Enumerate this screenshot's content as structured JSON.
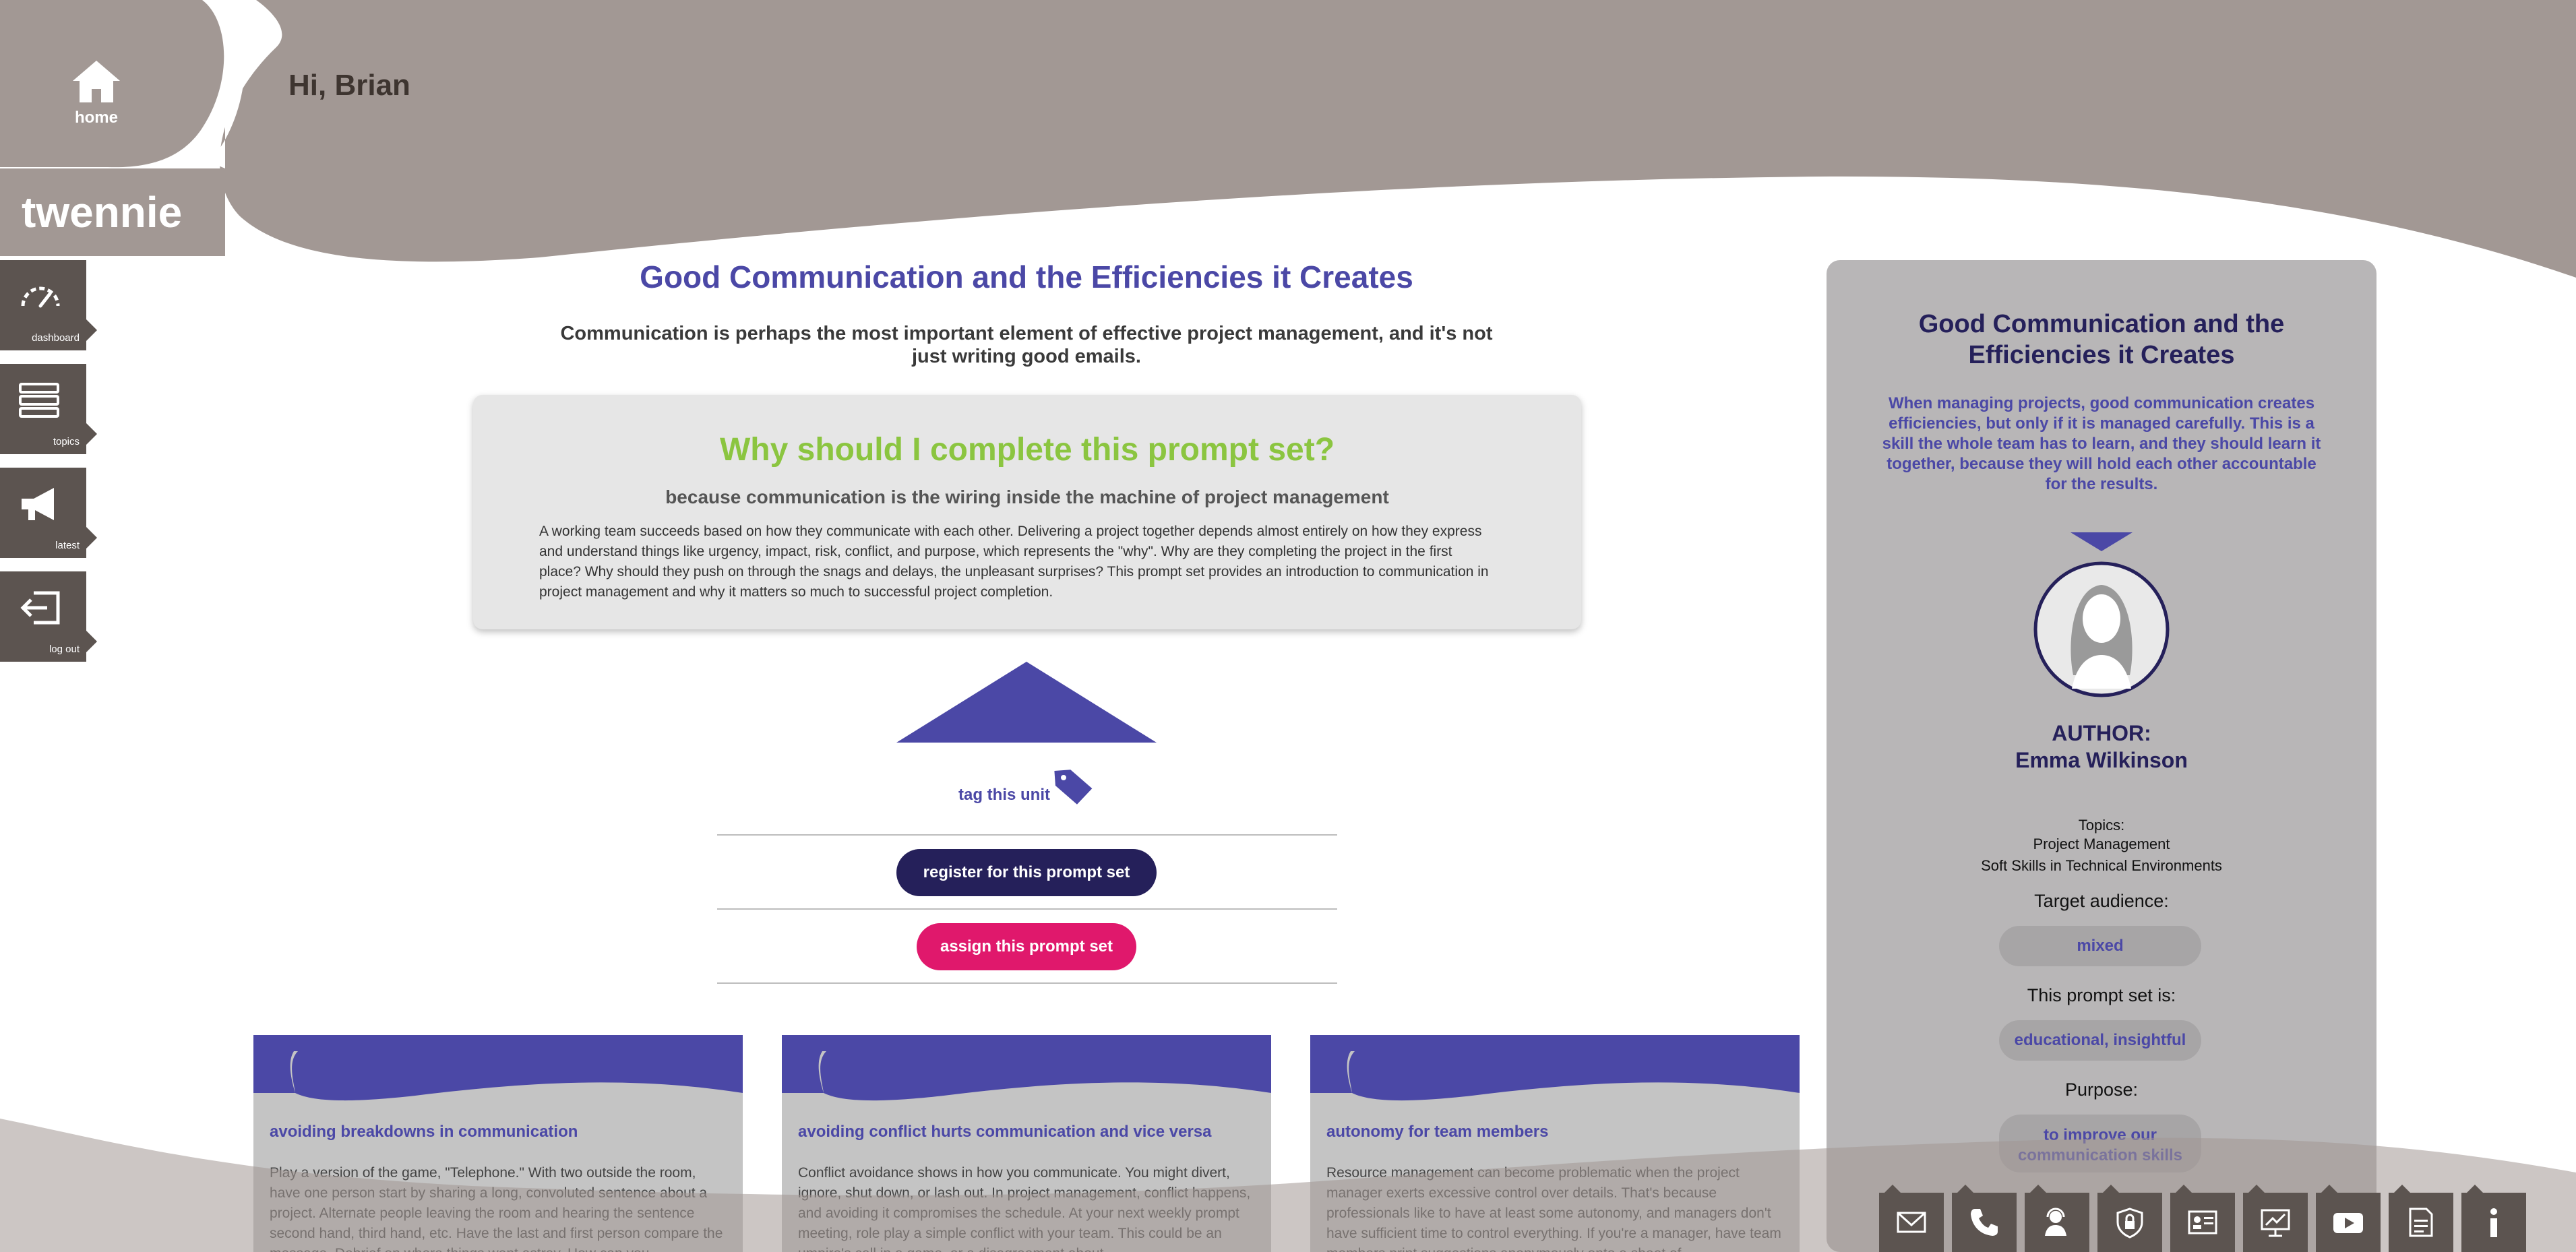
{
  "header": {
    "greeting": "Hi, Brian",
    "home_label": "home",
    "brand": "twennie"
  },
  "nav": {
    "items": [
      {
        "label": "dashboard",
        "icon": "speedometer-icon"
      },
      {
        "label": "topics",
        "icon": "list-icon"
      },
      {
        "label": "latest",
        "icon": "megaphone-icon"
      },
      {
        "label": "log out",
        "icon": "logout-icon"
      }
    ]
  },
  "main": {
    "title": "Good Communication and the Efficiencies it Creates",
    "subtitle": "Communication is perhaps the most important element of effective project management, and it's not just writing good emails.",
    "why": {
      "title": "Why should I complete this prompt set?",
      "subtitle": "because communication is the wiring inside the machine of project management",
      "body": "A working team succeeds based on how they communicate with each other. Delivering a project together depends almost entirely on how they express and understand things like urgency, impact, risk, conflict, and purpose, which represents the \"why\". Why are they completing the project in the first place? Why should they push on through the snags and delays, the unpleasant surprises? This prompt set provides an introduction to communication in project management and why it matters so much to successful project completion."
    },
    "tag_label": "tag this unit",
    "register_label": "register for this prompt set",
    "assign_label": "assign this prompt set"
  },
  "cards": [
    {
      "title": "avoiding breakdowns in communication",
      "body": "Play a version of the game, \"Telephone.\" With two outside the room, have one person start by sharing a long, convoluted sentence about a project. Alternate people leaving the room and hearing the sentence second hand, third hand, etc. Have the last and first person compare the message. Debrief on where things went astray. How can you"
    },
    {
      "title": "avoiding conflict hurts communication and vice versa",
      "body": "Conflict avoidance shows in how you communicate. You might divert, ignore, shut down, or lash out. In project management, conflict happens, and avoiding it compromises the schedule. At your next weekly prompt meeting, role play a simple conflict with your team. This could be an umpire's call in a game, or a disagreement about"
    },
    {
      "title": "autonomy for team members",
      "body": "Resource management can become problematic when the project manager exerts excessive control over details. That's because professionals like to have at least some autonomy, and managers don't have sufficient time to control everything. If you're a manager, have team members print suggestions anonymously onto a sheet of"
    }
  ],
  "panel": {
    "title": "Good Communication and the Efficiencies it Creates",
    "description": "When managing projects, good communication creates efficiencies, but only if it is managed carefully. This is a skill the whole team has to learn, and they should learn it together, because they will hold each other accountable for the results.",
    "author_label": "AUTHOR:",
    "author_name": "Emma Wilkinson",
    "topics_label": "Topics:",
    "topics": [
      "Project Management",
      "Soft Skills in Technical Environments"
    ],
    "audience_label": "Target audience:",
    "audience_value": "mixed",
    "set_is_label": "This prompt set is:",
    "set_is_value": "educational, insightful",
    "purpose_label": "Purpose:",
    "purpose_value": "to improve our communication skills"
  },
  "toolbar": {
    "items": [
      "mail-icon",
      "phone-icon",
      "support-agent-icon",
      "privacy-shield-icon",
      "id-card-icon",
      "presentation-icon",
      "video-play-icon",
      "terms-document-icon",
      "info-icon"
    ]
  },
  "colors": {
    "header_taupe": "#a29894",
    "nav_dark": "#5c5450",
    "title_indigo": "#4b48a6",
    "navy": "#25205a",
    "green": "#8bc540",
    "magenta": "#e0186c",
    "panel_grey": "#b8b6b7"
  }
}
